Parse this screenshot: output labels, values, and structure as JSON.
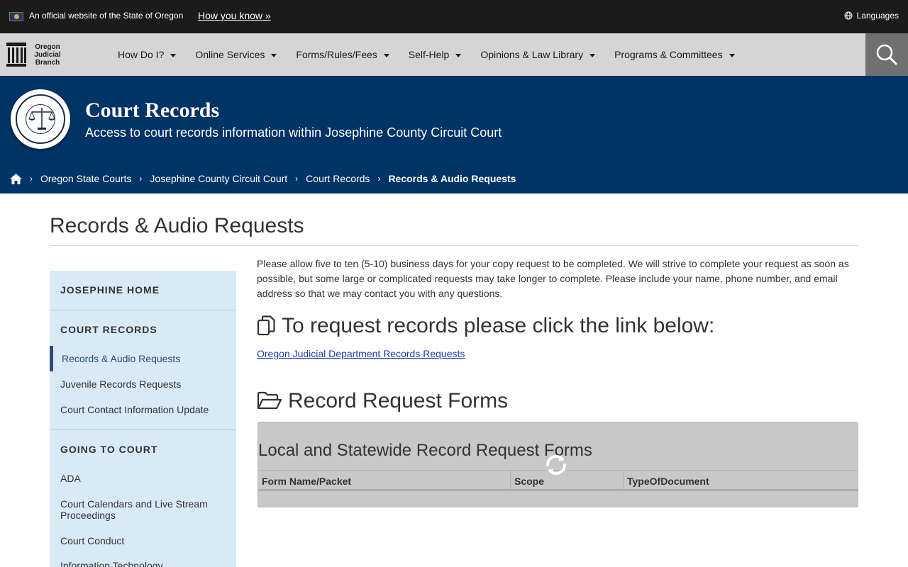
{
  "official": {
    "text": "An official website of the State of Oregon",
    "link": "How you know »",
    "languages": "Languages"
  },
  "logo": {
    "line1": "Oregon",
    "line2": "Judicial",
    "line3": "Branch"
  },
  "nav": {
    "items": [
      {
        "label": "How Do I?"
      },
      {
        "label": "Online Services"
      },
      {
        "label": "Forms/Rules/Fees"
      },
      {
        "label": "Self-Help"
      },
      {
        "label": "Opinions & Law Library"
      },
      {
        "label": "Programs & Committees"
      }
    ]
  },
  "hero": {
    "title": "Court Records",
    "subtitle": "Access to court records information within Josephine County Circuit Court"
  },
  "breadcrumb": {
    "items": [
      "Oregon State Courts",
      "Josephine County Circuit Court",
      "Court Records"
    ],
    "current": "Records & Audio Requests"
  },
  "page": {
    "title": "Records & Audio Requests"
  },
  "sidebar": {
    "home": "JOSEPHINE HOME",
    "court_records": "COURT RECORDS",
    "records_items": [
      "Records & Audio Requests",
      "Juvenile Records Requests",
      "Court Contact Information Update"
    ],
    "going_to_court": "GOING TO COURT",
    "court_items": [
      "ADA",
      "Court Calendars and Live Stream Proceedings",
      "Court Conduct",
      "Information Technology"
    ]
  },
  "content": {
    "intro": "Please allow five to ten (5-10) business days for your copy request to be completed. We will strive to complete your request as soon as possible, but some large or complicated requests may take longer to complete. Please include your name, phone number, and email address so that we may contact you with any questions.",
    "request_heading": "To request records please click the link below:",
    "request_link": "Oregon Judicial Department Records Requests",
    "forms_heading": "Record Request Forms",
    "table_caption": "Local and Statewide Record Request Forms",
    "columns": [
      "Form Name/Packet",
      "Scope",
      "TypeOfDocument"
    ]
  },
  "colors": {
    "hero": "#003366",
    "nav": "#d5d5d5",
    "sidebar": "#d9eaf7",
    "link": "#1a3cb0"
  }
}
